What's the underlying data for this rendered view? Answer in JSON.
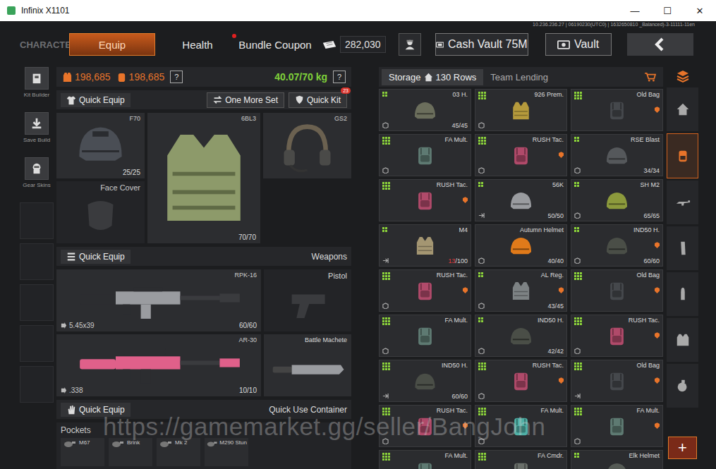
{
  "window": {
    "title": "Infinix X1101",
    "controls": [
      "—",
      "☐",
      "✕"
    ]
  },
  "server_info": "10.236.236.27 | 06190230(UTC0) | 1632650810 _Balanced)-3-11111-11en",
  "section": "CHARACTER",
  "tabs": [
    {
      "label": "Equip",
      "selected": true,
      "dot": false
    },
    {
      "label": "Health",
      "selected": false,
      "dot": false
    },
    {
      "label": "Bundle Coupon",
      "selected": false,
      "dot": true
    }
  ],
  "currency": "282,030",
  "buttons": [
    {
      "label": "Cash Vault 75M",
      "kind": "cash"
    },
    {
      "label": "Vault",
      "kind": "vault"
    }
  ],
  "tools": [
    {
      "label": "Kit Builder",
      "kind": "kit"
    },
    {
      "label": "Save Build",
      "kind": "save"
    },
    {
      "label": "Gear Skins",
      "kind": "skins"
    },
    {
      "kind": "slot"
    },
    {
      "kind": "slot"
    },
    {
      "kind": "slot"
    },
    {
      "kind": "slot"
    },
    {
      "kind": "slot"
    }
  ],
  "stats": {
    "armor": [
      "198,685",
      "198,685"
    ],
    "help": "?",
    "weight": "40.07/70 kg"
  },
  "gear_bar": {
    "quick_equip": "Quick Equip",
    "one_more_set": "One More Set",
    "quick_kit": "Quick Kit",
    "badge": "23"
  },
  "gear": [
    {
      "name": "F70",
      "kind": "helmet",
      "durability": "25/25",
      "color": "#4a4e55"
    },
    {
      "name": "6BL3",
      "kind": "vest",
      "durability": "70/70",
      "color": "#8d9a6a"
    },
    {
      "name": "GS2",
      "kind": "headset",
      "color": "#6b6150"
    },
    {
      "name": "Face Cover",
      "kind": "face",
      "color": "#3a3b3e"
    }
  ],
  "weapons_bar": {
    "quick_equip": "Quick Equip",
    "title": "Weapons"
  },
  "weapons": [
    {
      "name": "RPK-16",
      "kind": "rifle",
      "ammo": "5.45x39",
      "count": "60/60",
      "color": "#9a9ca0"
    },
    {
      "name": "AR-30",
      "kind": "sniper",
      "ammo": ".338",
      "count": "10/10",
      "color": "#e0608a"
    }
  ],
  "sidearms": [
    {
      "name": "Pistol",
      "kind": "pistol",
      "equipped": false
    },
    {
      "name": "Battle Machete",
      "kind": "machete",
      "equipped": true
    }
  ],
  "container_bar": {
    "quick_equip": "Quick Equip",
    "title": "Quick Use Container"
  },
  "pockets": {
    "title": "Pockets",
    "items": [
      "M67",
      "Brink",
      "Mk 2",
      "M290 Stun"
    ]
  },
  "storage": {
    "tabs": [
      {
        "label": "Storage",
        "selected": true,
        "rows": "130 Rows"
      },
      {
        "label": "Team Lending",
        "selected": false
      }
    ],
    "items": [
      {
        "name": "03 H.",
        "kind": "helmet",
        "color": "#6b6e5c",
        "grid": 2,
        "tag": false,
        "corner": "box",
        "durability": {
          "current": "45",
          "rest": "/45",
          "low": false
        }
      },
      {
        "name": "926 Prem.",
        "kind": "vest",
        "color": "#b59a3c",
        "grid": 3,
        "tag": false,
        "corner": "box"
      },
      {
        "name": "Old Bag",
        "kind": "backpack",
        "color": "#45484c",
        "grid": 3,
        "tag": true,
        "corner": "none"
      },
      {
        "name": "FA Mult.",
        "kind": "backpack",
        "color": "#5e7a72",
        "grid": 3,
        "tag": false,
        "corner": "box"
      },
      {
        "name": "RUSH Tac.",
        "kind": "backpack",
        "color": "#b04a6a",
        "grid": 3,
        "tag": true,
        "corner": "box"
      },
      {
        "name": "RSE Blast",
        "kind": "helmet",
        "color": "#55585b",
        "grid": 2,
        "tag": false,
        "corner": "box",
        "durability": {
          "current": "34",
          "rest": "/34",
          "low": false
        }
      },
      {
        "name": "RUSH Tac.",
        "kind": "backpack",
        "color": "#b04a6a",
        "grid": 3,
        "tag": true,
        "corner": "none"
      },
      {
        "name": "56K",
        "kind": "helmet",
        "color": "#9a9ca0",
        "grid": 2,
        "tag": false,
        "corner": "exit",
        "durability": {
          "current": "50",
          "rest": "/50",
          "low": false
        }
      },
      {
        "name": "SH M2",
        "kind": "helmet",
        "color": "#8c9a3c",
        "grid": 2,
        "tag": false,
        "corner": "box",
        "durability": {
          "current": "65",
          "rest": "/65",
          "low": false
        }
      },
      {
        "name": "M4",
        "kind": "vest",
        "color": "#a49672",
        "grid": 2,
        "tag": false,
        "corner": "exit",
        "durability": {
          "current": "13",
          "rest": "/100",
          "low": true
        }
      },
      {
        "name": "Autumn Helmet",
        "kind": "helmet",
        "color": "#e07a1a",
        "grid": 0,
        "tag": false,
        "corner": "box",
        "durability": {
          "current": "40",
          "rest": "/40",
          "low": false
        }
      },
      {
        "name": "IND50 H.",
        "kind": "helmet",
        "color": "#4a4e47",
        "grid": 2,
        "tag": true,
        "corner": "box",
        "durability": {
          "current": "60",
          "rest": "/60",
          "low": false
        }
      },
      {
        "name": "RUSH Tac.",
        "kind": "backpack",
        "color": "#b04a6a",
        "grid": 3,
        "tag": true,
        "corner": "box"
      },
      {
        "name": "AL Reg.",
        "kind": "vest",
        "color": "#7d8284",
        "grid": 2,
        "tag": true,
        "corner": "box",
        "durability": {
          "current": "43",
          "rest": "/45",
          "low": false
        }
      },
      {
        "name": "Old Bag",
        "kind": "backpack",
        "color": "#45484c",
        "grid": 3,
        "tag": true,
        "corner": "none"
      },
      {
        "name": "FA Mult.",
        "kind": "backpack",
        "color": "#5e7a72",
        "grid": 3,
        "tag": false,
        "corner": "box"
      },
      {
        "name": "IND50 H.",
        "kind": "helmet",
        "color": "#4a4e47",
        "grid": 2,
        "tag": false,
        "corner": "box",
        "durability": {
          "current": "42",
          "rest": "/42",
          "low": false
        }
      },
      {
        "name": "RUSH Tac.",
        "kind": "backpack",
        "color": "#b04a6a",
        "grid": 3,
        "tag": true,
        "corner": "box"
      },
      {
        "name": "IND50 H.",
        "kind": "helmet",
        "color": "#4a4e47",
        "grid": 3,
        "tag": false,
        "corner": "exit",
        "durability": {
          "current": "60",
          "rest": "/60",
          "low": false
        }
      },
      {
        "name": "RUSH Tac.",
        "kind": "backpack",
        "color": "#b04a6a",
        "grid": 3,
        "tag": true,
        "corner": "box"
      },
      {
        "name": "Old Bag",
        "kind": "backpack",
        "color": "#45484c",
        "grid": 3,
        "tag": true,
        "corner": "exit"
      },
      {
        "name": "RUSH Tac.",
        "kind": "backpack",
        "color": "#b04a6a",
        "grid": 3,
        "tag": true,
        "corner": "box"
      },
      {
        "name": "FA Mult.",
        "kind": "backpack",
        "color": "#4fb0a6",
        "grid": 3,
        "tag": false,
        "corner": "box"
      },
      {
        "name": "FA Mult.",
        "kind": "backpack",
        "color": "#5e7a72",
        "grid": 3,
        "tag": true,
        "corner": "box"
      },
      {
        "name": "FA Mult.",
        "kind": "backpack",
        "color": "#5e7a72",
        "grid": 3,
        "tag": false,
        "corner": "none"
      },
      {
        "name": "FA Cmdr.",
        "kind": "backpack",
        "color": "#6a6f6a",
        "grid": 3,
        "tag": false,
        "corner": "none"
      },
      {
        "name": "Elk Helmet",
        "kind": "helmet",
        "color": "#555a55",
        "grid": 2,
        "tag": false,
        "corner": "none"
      }
    ]
  },
  "categories": [
    {
      "kind": "home",
      "selected": false
    },
    {
      "kind": "backpack",
      "selected": true
    },
    {
      "kind": "rifle",
      "selected": false
    },
    {
      "kind": "magazine",
      "selected": false
    },
    {
      "kind": "ammo",
      "selected": false
    },
    {
      "kind": "vest",
      "selected": false
    },
    {
      "kind": "grenade",
      "selected": false
    }
  ],
  "add_button": "+",
  "watermark": "https://gamemarket.gg/seller/BangJohn"
}
